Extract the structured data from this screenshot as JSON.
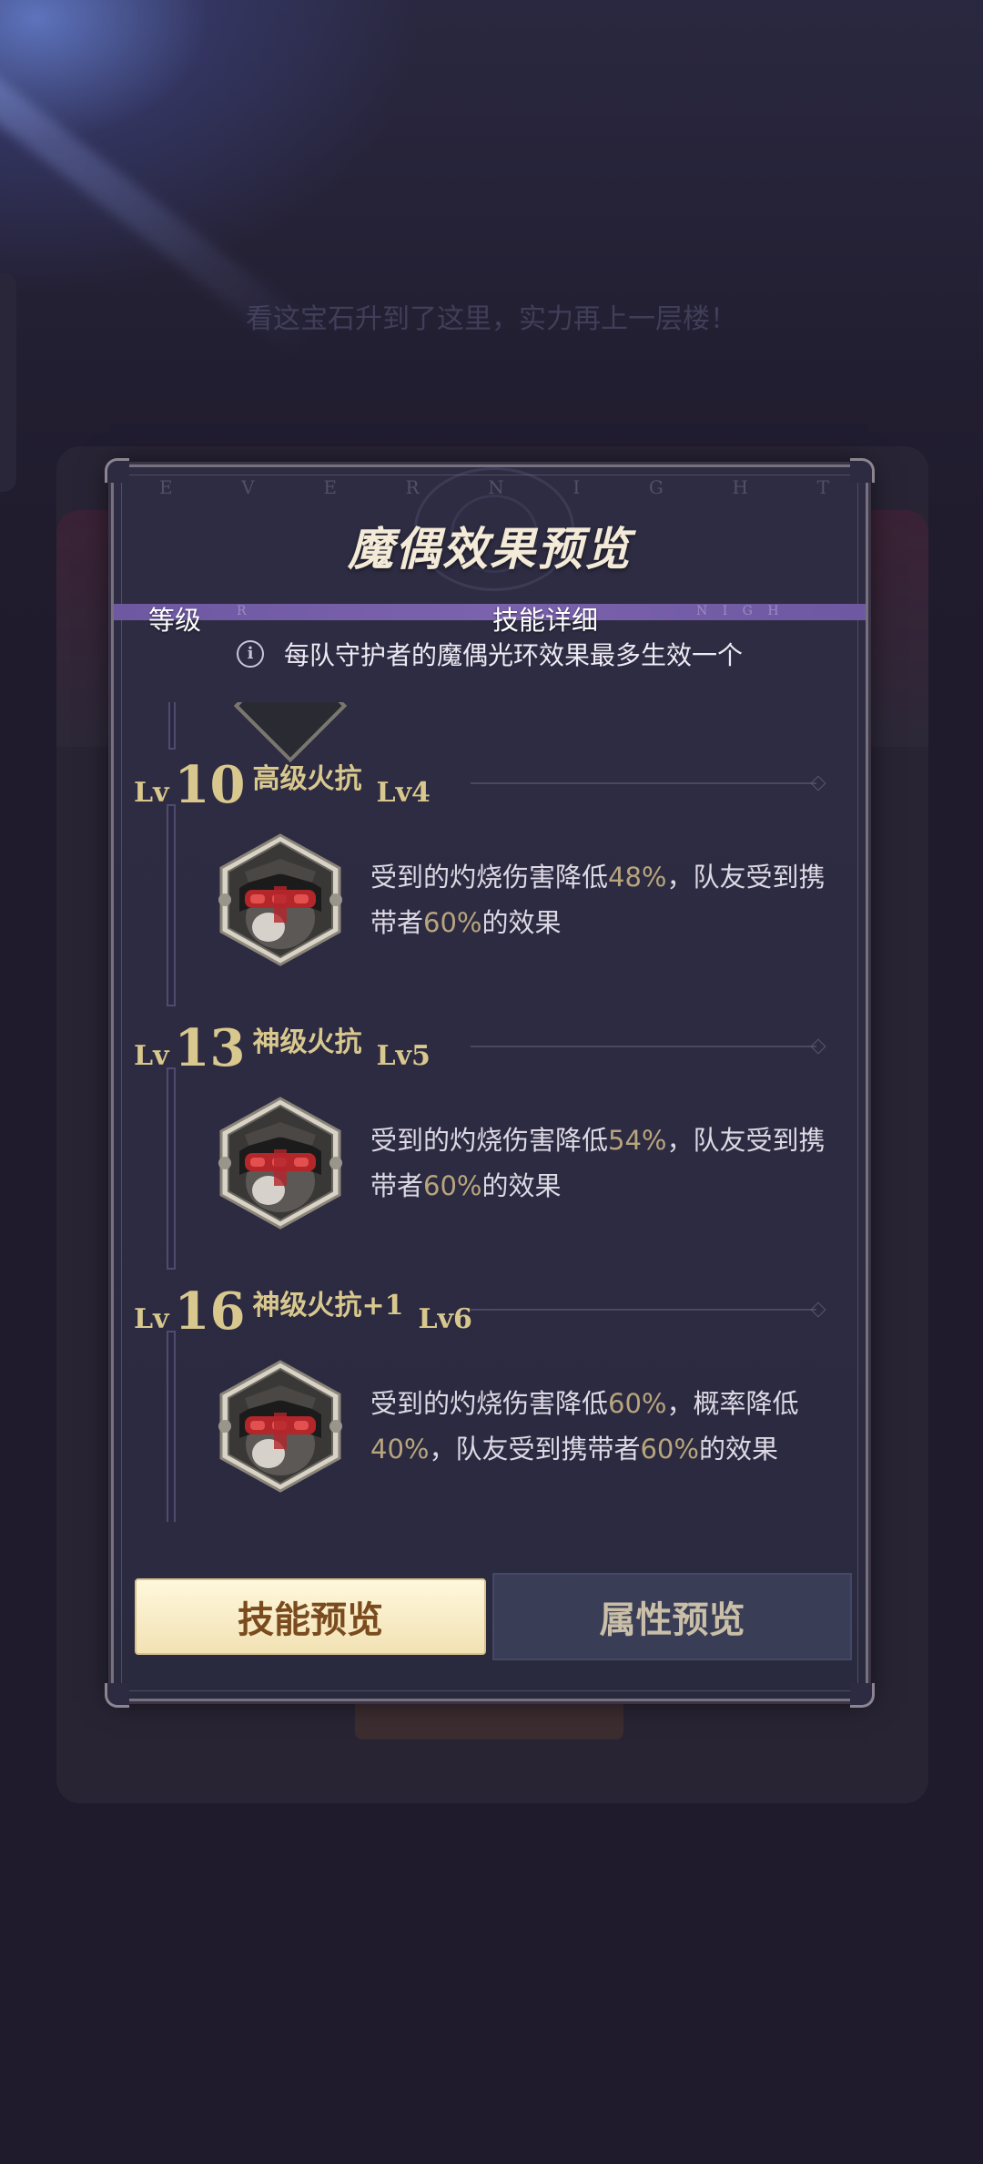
{
  "background": {
    "banner_text": "看这宝石升到了这里，实力再上一层楼！"
  },
  "dialog": {
    "title": "魔偶效果预览",
    "watermark_letters": [
      "E",
      "V",
      "E",
      "R",
      "N",
      "I",
      "G",
      "H",
      "T"
    ],
    "bar_marks": {
      "left": "R",
      "right": "N I G H"
    },
    "columns": {
      "level": "等级",
      "detail": "技能详细"
    },
    "notice": "每队守护者的魔偶光环效果最多生效一个",
    "info_icon": "info-icon",
    "tiers": [
      {
        "lv_prefix": "Lv",
        "level": "10",
        "name": "高级火抗",
        "skill_lv": "Lv4",
        "desc": [
          {
            "t": "受到的灼烧伤害降低",
            "h": false
          },
          {
            "t": "48%",
            "h": true
          },
          {
            "t": "，队友受到携带者",
            "h": false
          },
          {
            "t": "60%",
            "h": true
          },
          {
            "t": "的效果",
            "h": false
          }
        ]
      },
      {
        "lv_prefix": "Lv",
        "level": "13",
        "name": "神级火抗",
        "skill_lv": "Lv5",
        "desc": [
          {
            "t": "受到的灼烧伤害降低",
            "h": false
          },
          {
            "t": "54%",
            "h": true
          },
          {
            "t": "，队友受到携带者",
            "h": false
          },
          {
            "t": "60%",
            "h": true
          },
          {
            "t": "的效果",
            "h": false
          }
        ]
      },
      {
        "lv_prefix": "Lv",
        "level": "16",
        "name": "神级火抗+1",
        "skill_lv": "Lv6",
        "desc": [
          {
            "t": "受到的灼烧伤害降低",
            "h": false
          },
          {
            "t": "60%",
            "h": true
          },
          {
            "t": "，概率降低",
            "h": false
          },
          {
            "t": "40%",
            "h": true
          },
          {
            "t": "，队友受到携带者",
            "h": false
          },
          {
            "t": "60%",
            "h": true
          },
          {
            "t": "的效果",
            "h": false
          }
        ]
      }
    ],
    "buttons": {
      "skills": "技能预览",
      "attributes": "属性预览"
    },
    "colors": {
      "highlight": "#b8a57d",
      "gold": "#d9c88e",
      "bar": "#7b62ad"
    }
  }
}
